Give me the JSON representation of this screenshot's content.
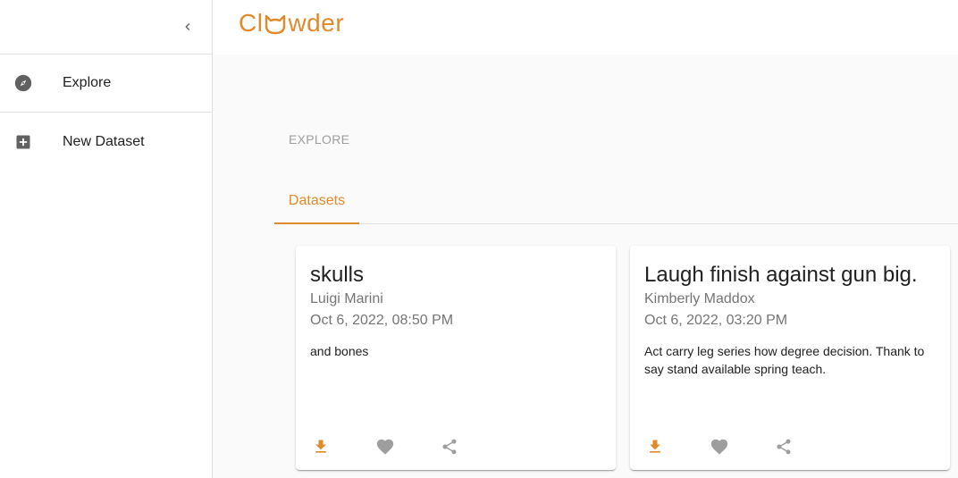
{
  "app": {
    "logo_text_pre": "Cl",
    "logo_text_post": "wder",
    "brand_color": "#e08a2b"
  },
  "sidebar": {
    "items": [
      {
        "label": "Explore",
        "icon": "compass-icon"
      },
      {
        "label": "New Dataset",
        "icon": "add-box-icon"
      }
    ]
  },
  "main": {
    "breadcrumb": "EXPLORE",
    "tabs": [
      {
        "label": "Datasets"
      }
    ],
    "cards": [
      {
        "title": "skulls",
        "author": "Luigi Marini",
        "date": "Oct 6, 2022, 08:50 PM",
        "description": "and bones"
      },
      {
        "title": "Laugh finish against gun big.",
        "author": "Kimberly Maddox",
        "date": "Oct 6, 2022, 03:20 PM",
        "description": "Act carry leg series how degree decision. Thank to say stand available spring teach."
      }
    ]
  }
}
